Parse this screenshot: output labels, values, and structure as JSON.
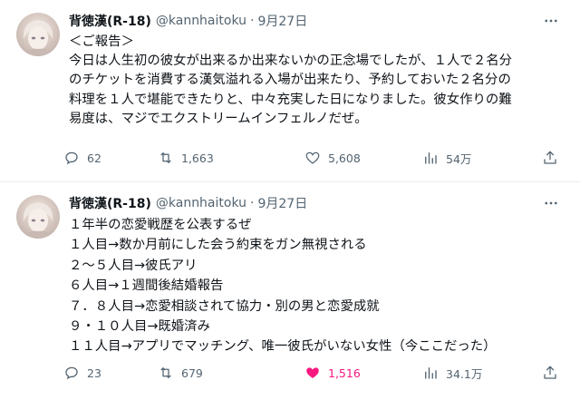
{
  "colors": {
    "text": "#0f1419",
    "secondary": "#536471",
    "like_active": "#f91880",
    "divider": "#e8ecef"
  },
  "tweets": [
    {
      "author": {
        "name": "背徳漢(R-18)",
        "handle": "@kannhaitoku",
        "avatar_icon": "avatar-image"
      },
      "separator": "·",
      "date": "9月27日",
      "lines": [
        "＜ご報告＞",
        "今日は人生初の彼女が出来るか出来ないかの正念場でしたが、１人で２名分",
        "のチケットを消費する漢気溢れる入場が出来たり、予約しておいた２名分の",
        "料理を１人で堪能できたりと、中々充実した日になりました。彼女作りの難",
        "易度は、マジでエクストリームインフェルノだぜ。"
      ],
      "stats": {
        "replies": "62",
        "retweets": "1,663",
        "likes": "5,608",
        "views": "54万",
        "liked": false
      }
    },
    {
      "author": {
        "name": "背徳漢(R-18)",
        "handle": "@kannhaitoku",
        "avatar_icon": "avatar-image"
      },
      "separator": "·",
      "date": "9月27日",
      "lines": [
        "１年半の恋愛戦歴を公表するぜ",
        "１人目→数か月前にした会う約束をガン無視される",
        "２～５人目→彼氏アリ",
        "６人目→１週間後結婚報告",
        "７．８人目→恋愛相談されて協力・別の男と恋愛成就",
        "９・１０人目→既婚済み",
        "１１人目→アプリでマッチング、唯一彼氏がいない女性（今ここだった）"
      ],
      "stats": {
        "replies": "23",
        "retweets": "679",
        "likes": "1,516",
        "views": "34.1万",
        "liked": true
      }
    }
  ]
}
